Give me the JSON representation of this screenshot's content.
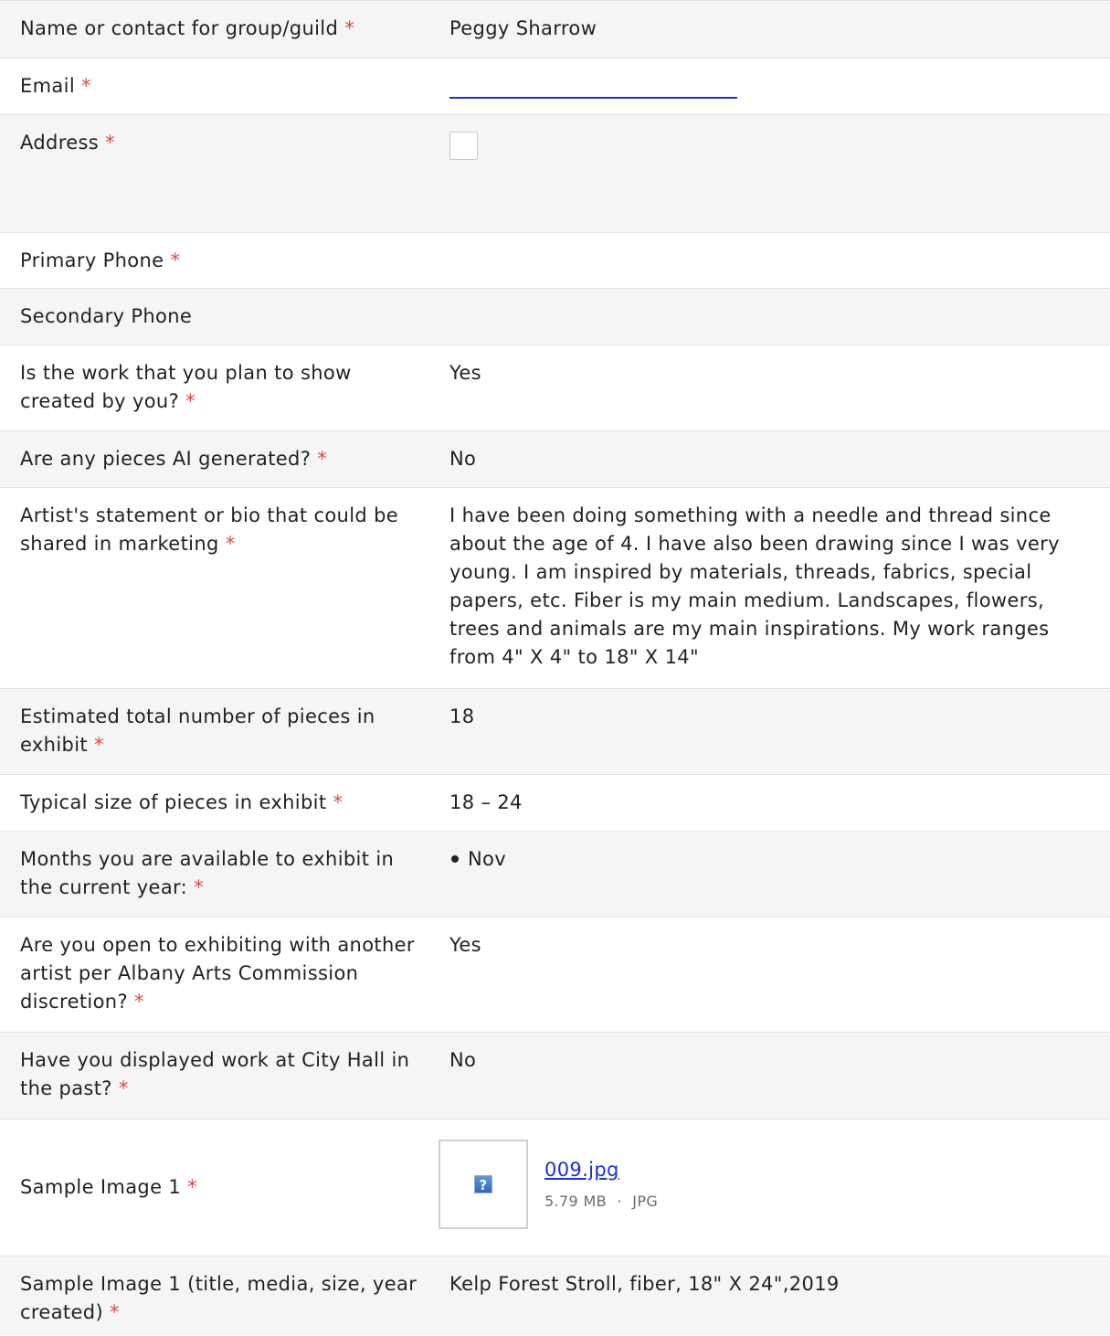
{
  "required_mark": "*",
  "fields": [
    {
      "label": "Name or contact for group/guild",
      "value": "Peggy  Sharrow"
    },
    {
      "label": "Email"
    },
    {
      "label": "Address"
    },
    {
      "label": "Primary Phone"
    },
    {
      "label": "Secondary Phone"
    },
    {
      "label": "Is the work that you plan to show created by you?",
      "value": "Yes"
    },
    {
      "label": "Are any pieces AI generated?",
      "value": "No"
    },
    {
      "label": "Artist's statement or bio that could be shared in marketing",
      "value": "I have been doing something with a needle and thread since about the age of 4. I have also been drawing since I was very young. I am inspired by materials, threads, fabrics, special papers, etc. Fiber is my main medium. Landscapes, flowers, trees and animals are my main inspirations. My work ranges from 4\" X 4\" to 18\" X 14\""
    },
    {
      "label": "Estimated total number of pieces in exhibit",
      "value": "18"
    },
    {
      "label": "Typical size of pieces in exhibit",
      "value": "18 – 24"
    },
    {
      "label": "Months you are available to exhibit in the current year:",
      "values": [
        "Nov"
      ]
    },
    {
      "label": "Are you open to exhibiting with another artist per Albany Arts Commission discretion?",
      "value": "Yes"
    },
    {
      "label": "Have you displayed work at City Hall in the past?",
      "value": "No"
    },
    {
      "label": "Sample Image 1",
      "file": {
        "name": "009.jpg",
        "size": "5.79 MB",
        "separator": "·",
        "type": "JPG",
        "icon": "broken-image-icon"
      }
    },
    {
      "label": "Sample Image 1 (title, media, size, year created)",
      "value": "Kelp Forest Stroll, fiber, 18\" X 24\",2019"
    }
  ]
}
